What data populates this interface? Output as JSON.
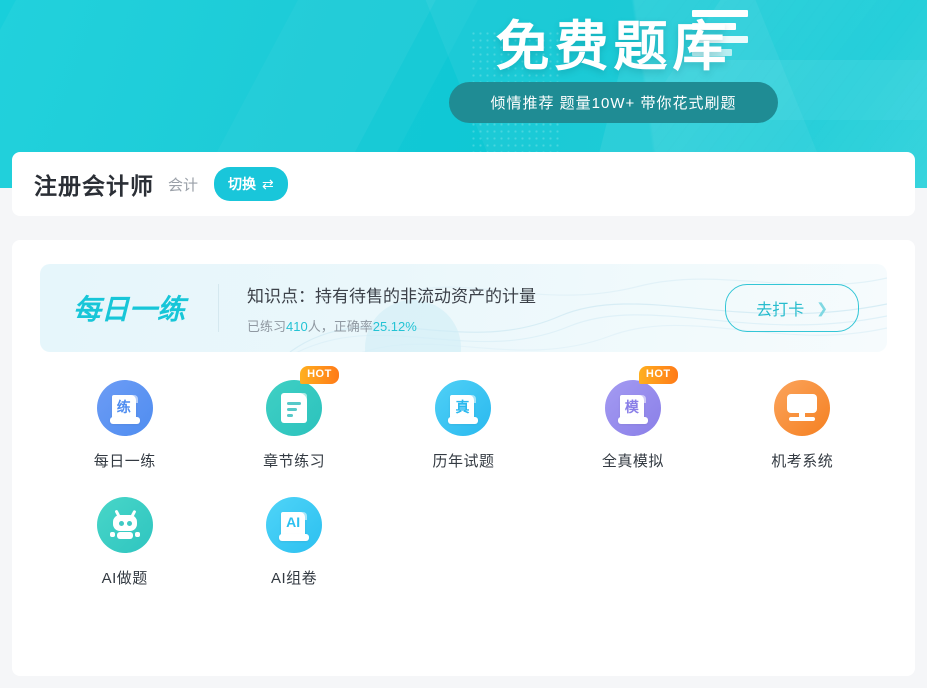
{
  "banner": {
    "title": "免费题库",
    "subtitle": "倾情推荐 题量10W+ 带你花式刷题"
  },
  "header": {
    "title": "注册会计师",
    "subject": "会计",
    "switch_label": "切换",
    "switch_icon": "swap-arrows-icon"
  },
  "daily": {
    "logo": "每日一练",
    "knowledge_point": "知识点：持有待售的非流动资产的计量",
    "stat_prefix": "已练习",
    "stat_count": "410",
    "stat_middle": "人，正确率",
    "stat_rate": "25.12%",
    "button_label": "去打卡",
    "button_icon": "chevron-right-icon"
  },
  "tiles": [
    {
      "label": "每日一练",
      "glyph": "练",
      "badge": "",
      "kind": "scroll",
      "c1": "#6d9cf5",
      "c2": "#4f8df0",
      "text_color": "#4f8df0"
    },
    {
      "label": "章节练习",
      "glyph": "",
      "badge": "HOT",
      "kind": "doc",
      "c1": "#3fd0c4",
      "c2": "#2cc2bd",
      "text_color": "#2cc2bd"
    },
    {
      "label": "历年试题",
      "glyph": "真",
      "badge": "",
      "kind": "scroll",
      "c1": "#4fd0f6",
      "c2": "#2ab9ef",
      "text_color": "#2ab9ef"
    },
    {
      "label": "全真模拟",
      "glyph": "模",
      "badge": "HOT",
      "kind": "scroll",
      "c1": "#a49bf2",
      "c2": "#8a7fe8",
      "text_color": "#8a7fe8"
    },
    {
      "label": "机考系统",
      "glyph": "",
      "badge": "",
      "kind": "monitor",
      "c1": "#fba45c",
      "c2": "#f58021",
      "text_color": "#f58021"
    },
    {
      "label": "AI做题",
      "glyph": "",
      "badge": "",
      "kind": "robot",
      "c1": "#48d6c8",
      "c2": "#2fc5c0",
      "text_color": "#2fc5c0"
    },
    {
      "label": "AI组卷",
      "glyph": "AI",
      "badge": "",
      "kind": "scroll",
      "c1": "#4fd4f8",
      "c2": "#2cc0f0",
      "text_color": "#2cc0f0"
    }
  ],
  "colors": {
    "banner": "#14cbd8",
    "accent": "#19c6da",
    "hot": "#ff8a1f",
    "orange": "#f5a623"
  }
}
